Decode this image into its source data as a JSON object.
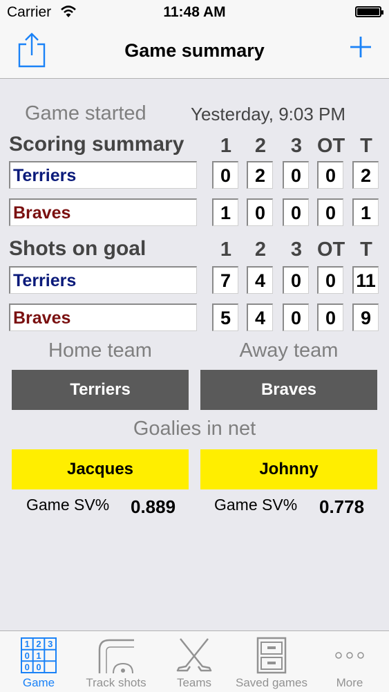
{
  "status": {
    "carrier": "Carrier",
    "time": "11:48 AM"
  },
  "nav": {
    "title": "Game summary",
    "share_icon": "share-icon",
    "add_icon": "add-icon"
  },
  "game_started": {
    "label": "Game started",
    "value": "Yesterday, 9:03 PM"
  },
  "columns": [
    "1",
    "2",
    "3",
    "OT",
    "T"
  ],
  "scoring": {
    "title": "Scoring summary",
    "rows": [
      {
        "team": "Terriers",
        "values": [
          "0",
          "2",
          "0",
          "0",
          "2"
        ]
      },
      {
        "team": "Braves",
        "values": [
          "1",
          "0",
          "0",
          "0",
          "1"
        ]
      }
    ]
  },
  "shots": {
    "title": "Shots on goal",
    "rows": [
      {
        "team": "Terriers",
        "values": [
          "7",
          "4",
          "0",
          "0",
          "11"
        ]
      },
      {
        "team": "Braves",
        "values": [
          "5",
          "4",
          "0",
          "0",
          "9"
        ]
      }
    ]
  },
  "teams": {
    "home_label": "Home team",
    "away_label": "Away team",
    "home": "Terriers",
    "away": "Braves"
  },
  "goalies": {
    "title": "Goalies in net",
    "home": {
      "name": "Jacques",
      "sv_label": "Game SV%",
      "sv": "0.889"
    },
    "away": {
      "name": "Johnny",
      "sv_label": "Game SV%",
      "sv": "0.778"
    }
  },
  "colors": {
    "home": "#0a1a7a",
    "away": "#7a1010",
    "goalie": "#ffee00",
    "team_button": "#5a5a5a",
    "tint": "#1a82f7"
  },
  "tabs": [
    {
      "label": "Game",
      "icon": "scoreboard-icon",
      "active": true
    },
    {
      "label": "Track shots",
      "icon": "rink-icon",
      "active": false
    },
    {
      "label": "Teams",
      "icon": "hockey-sticks-icon",
      "active": false
    },
    {
      "label": "Saved games",
      "icon": "file-cabinet-icon",
      "active": false
    },
    {
      "label": "More",
      "icon": "more-icon",
      "active": false
    }
  ]
}
